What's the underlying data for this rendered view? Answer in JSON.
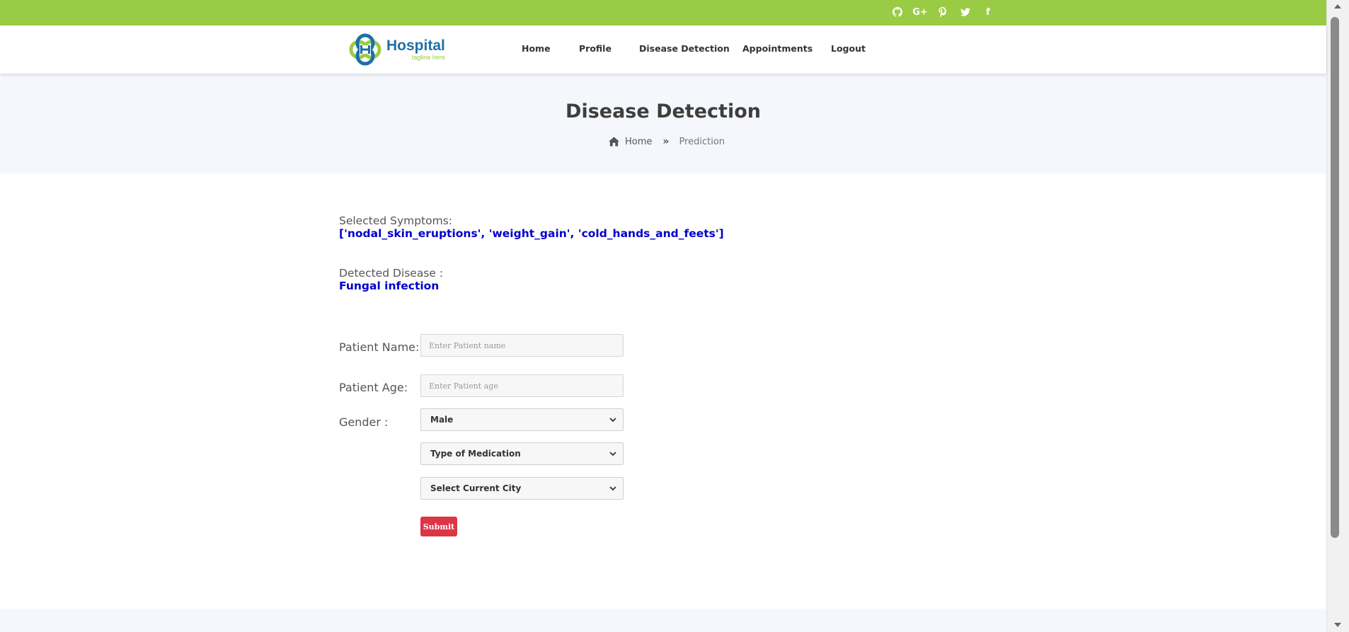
{
  "colors": {
    "topbar": "#99cc44",
    "brand_blue": "#1e6fa8",
    "result_blue": "#0000cc",
    "submit": "#dc3545"
  },
  "topbar": {
    "social_icons": [
      "github-icon",
      "google-plus-icon",
      "pinterest-icon",
      "twitter-icon",
      "facebook-icon"
    ],
    "google_plus_text": "G+",
    "facebook_text": "f"
  },
  "logo": {
    "name": "Hospital",
    "tagline": "tagline here"
  },
  "nav": {
    "items": [
      "Home",
      "Profile",
      "Disease Detection",
      "Appointments",
      "Logout"
    ]
  },
  "banner": {
    "title": "Disease Detection",
    "breadcrumb": {
      "home": "Home",
      "separator": "»",
      "current": "Prediction"
    }
  },
  "result": {
    "symptoms_label": "Selected Symptoms:",
    "symptoms_value": "['nodal_skin_eruptions', 'weight_gain', 'cold_hands_and_feets']",
    "disease_label": "Detected Disease :",
    "disease_value": "Fungal infection"
  },
  "form": {
    "name_label": "Patient Name:",
    "name_placeholder": "Enter Patient name",
    "age_label": "Patient Age:",
    "age_placeholder": "Enter Patient age",
    "gender_label": "Gender :",
    "gender_selected": "Male",
    "medication_selected": "Type of Medication",
    "city_selected": "Select Current City",
    "submit_label": "Submit"
  }
}
